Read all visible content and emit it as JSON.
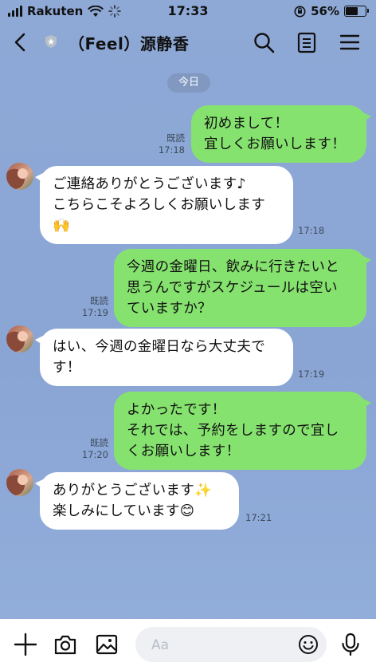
{
  "status_bar": {
    "carrier": "Rakuten",
    "time": "17:33",
    "battery_percent": "56%",
    "battery_level": 0.56
  },
  "header": {
    "title": "（Feel）源静香",
    "icons": [
      "back-icon",
      "shield-icon",
      "search-icon",
      "notes-icon",
      "menu-icon"
    ]
  },
  "chat": {
    "date_label": "今日",
    "messages": [
      {
        "side": "out",
        "text": "初めまして！\n宜しくお願いします！",
        "read": "既読",
        "time": "17:18"
      },
      {
        "side": "in",
        "text": "ご連絡ありがとうございます♪\nこちらこそよろしくお願いします",
        "emoji": "🙌",
        "time": "17:18"
      },
      {
        "side": "out",
        "text": "今週の金曜日、飲みに行きたいと\n思うんですがスケジュールは空い\nていますか？",
        "read": "既読",
        "time": "17:19"
      },
      {
        "side": "in",
        "text": "はい、今週の金曜日なら大丈夫で\nす！",
        "time": "17:19"
      },
      {
        "side": "out",
        "text": "よかったです！\nそれでは、予約をしますので宜し\nくお願いします！",
        "read": "既読",
        "time": "17:20"
      },
      {
        "side": "in",
        "text_line1": "ありがとうございます",
        "emoji1": "✨",
        "text_line2": "楽しみにしています",
        "emoji2": "😊",
        "time": "17:21"
      }
    ]
  },
  "composer": {
    "placeholder": "Aa",
    "icons": [
      "plus-icon",
      "camera-icon",
      "image-icon",
      "emoji-icon",
      "microphone-icon"
    ]
  },
  "colors": {
    "background": "#8ea9d6",
    "outgoing_bubble": "#86e26f",
    "incoming_bubble": "#ffffff"
  }
}
